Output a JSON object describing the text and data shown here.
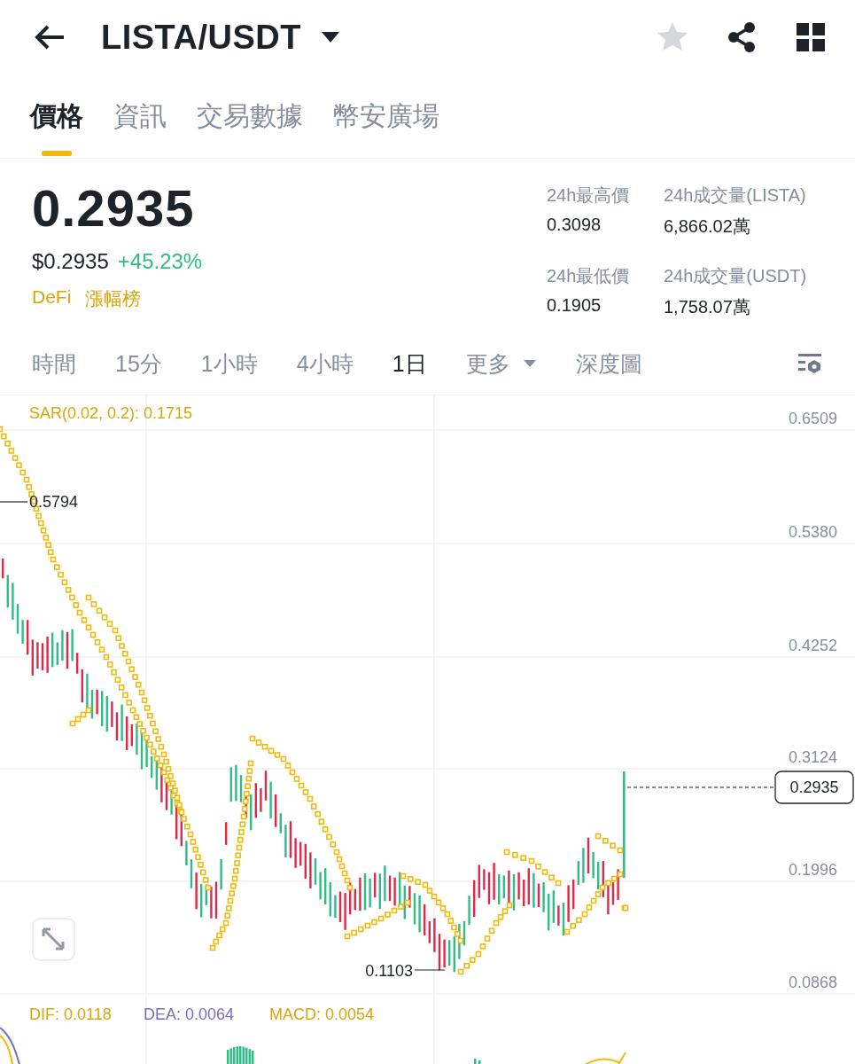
{
  "header": {
    "title": "LISTA/USDT",
    "favorite": false
  },
  "tabs": [
    {
      "label": "價格",
      "selected": true
    },
    {
      "label": "資訊",
      "selected": false
    },
    {
      "label": "交易數據",
      "selected": false
    },
    {
      "label": "幣安廣場",
      "selected": false
    }
  ],
  "price": {
    "last": "0.2935",
    "usd": "$0.2935",
    "change": "+45.23%",
    "tags": [
      "DeFi",
      "漲幅榜"
    ]
  },
  "stats": [
    {
      "label": "24h最高價",
      "value": "0.3098"
    },
    {
      "label": "24h成交量(LISTA)",
      "value": "6,866.02萬"
    },
    {
      "label": "24h最低價",
      "value": "0.1905"
    },
    {
      "label": "24h成交量(USDT)",
      "value": "1,758.07萬"
    }
  ],
  "intervals": [
    {
      "label": "時間",
      "kind": "option",
      "selected": false
    },
    {
      "label": "15分",
      "kind": "option",
      "selected": false
    },
    {
      "label": "1小時",
      "kind": "option",
      "selected": false
    },
    {
      "label": "4小時",
      "kind": "option",
      "selected": false
    },
    {
      "label": "1日",
      "kind": "option",
      "selected": true
    },
    {
      "label": "更多",
      "kind": "dropdown",
      "selected": false
    },
    {
      "label": "深度圖",
      "kind": "option",
      "selected": false
    }
  ],
  "chart": {
    "indicator": "SAR(0.02, 0.2): 0.1715",
    "axis_labels": [
      "0.6509",
      "0.5380",
      "0.4252",
      "0.3124",
      "0.1996",
      "0.0868"
    ],
    "high_marker": "0.5794",
    "low_marker": "0.1103",
    "current_price": "0.2935"
  },
  "macd": {
    "dif": "DIF: 0.0118",
    "dea": "DEA: 0.0064",
    "macd": "MACD: 0.0054"
  }
}
